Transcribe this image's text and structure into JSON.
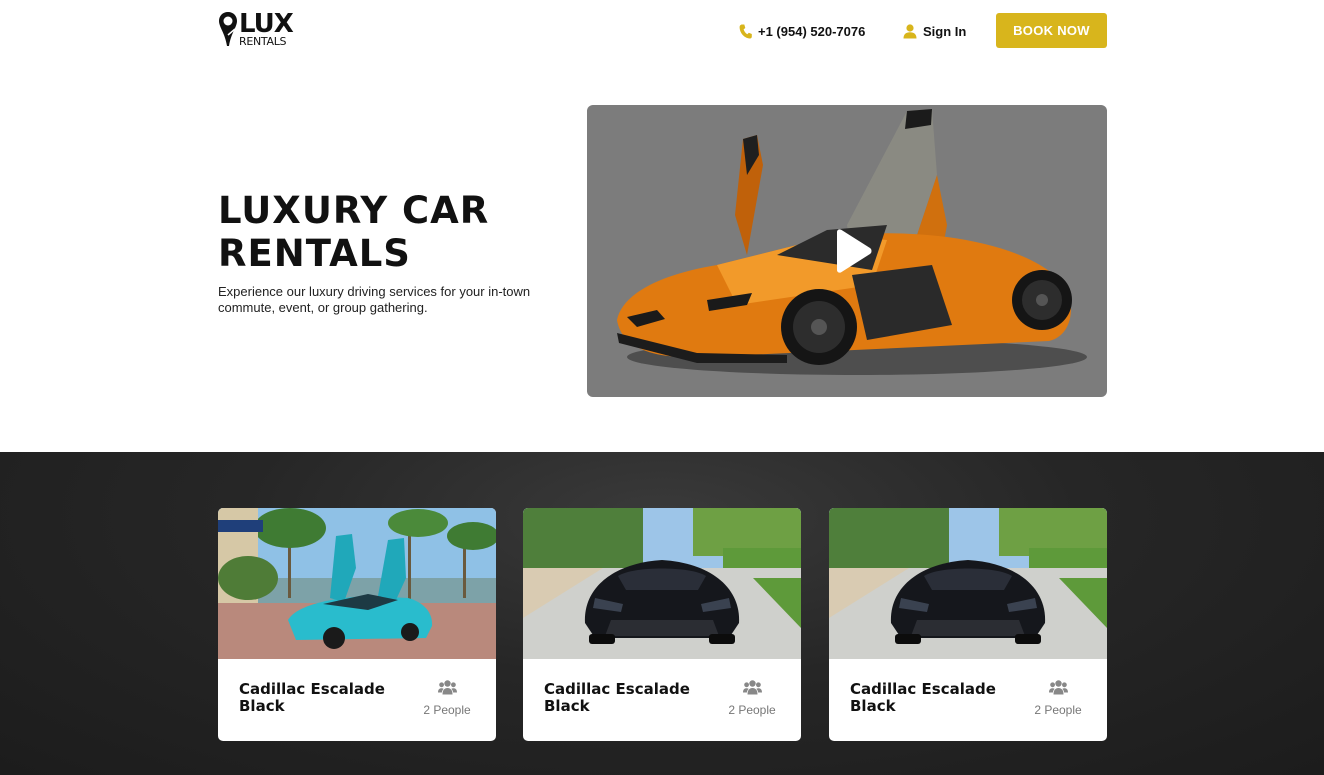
{
  "header": {
    "logo_text": "LUX",
    "logo_sub": "RENTALS",
    "phone": "+1 (954) 520-7076",
    "signin": "Sign In",
    "book_now": "BOOK NOW"
  },
  "hero": {
    "title": "LUXURY CAR RENTALS",
    "description": "Experience our luxury driving services for your in-town commute, event, or group gathering."
  },
  "cards": [
    {
      "title": "Cadillac Escalade Black",
      "capacity": "2 People",
      "photo": "teal-sports-car-photo"
    },
    {
      "title": "Cadillac Escalade Black",
      "capacity": "2 People",
      "photo": "black-sports-car-photo"
    },
    {
      "title": "Cadillac Escalade Black",
      "capacity": "2 People",
      "photo": "black-sports-car-photo"
    }
  ],
  "colors": {
    "accent": "#d8b51c",
    "dark_bg": "#262626",
    "video_overlay": "#7c7c7c",
    "car_orange": "#e07a10"
  },
  "icons": {
    "phone": "phone-icon",
    "user": "user-icon",
    "play": "play-icon",
    "people": "people-icon",
    "logo": "map-pin-icon"
  }
}
